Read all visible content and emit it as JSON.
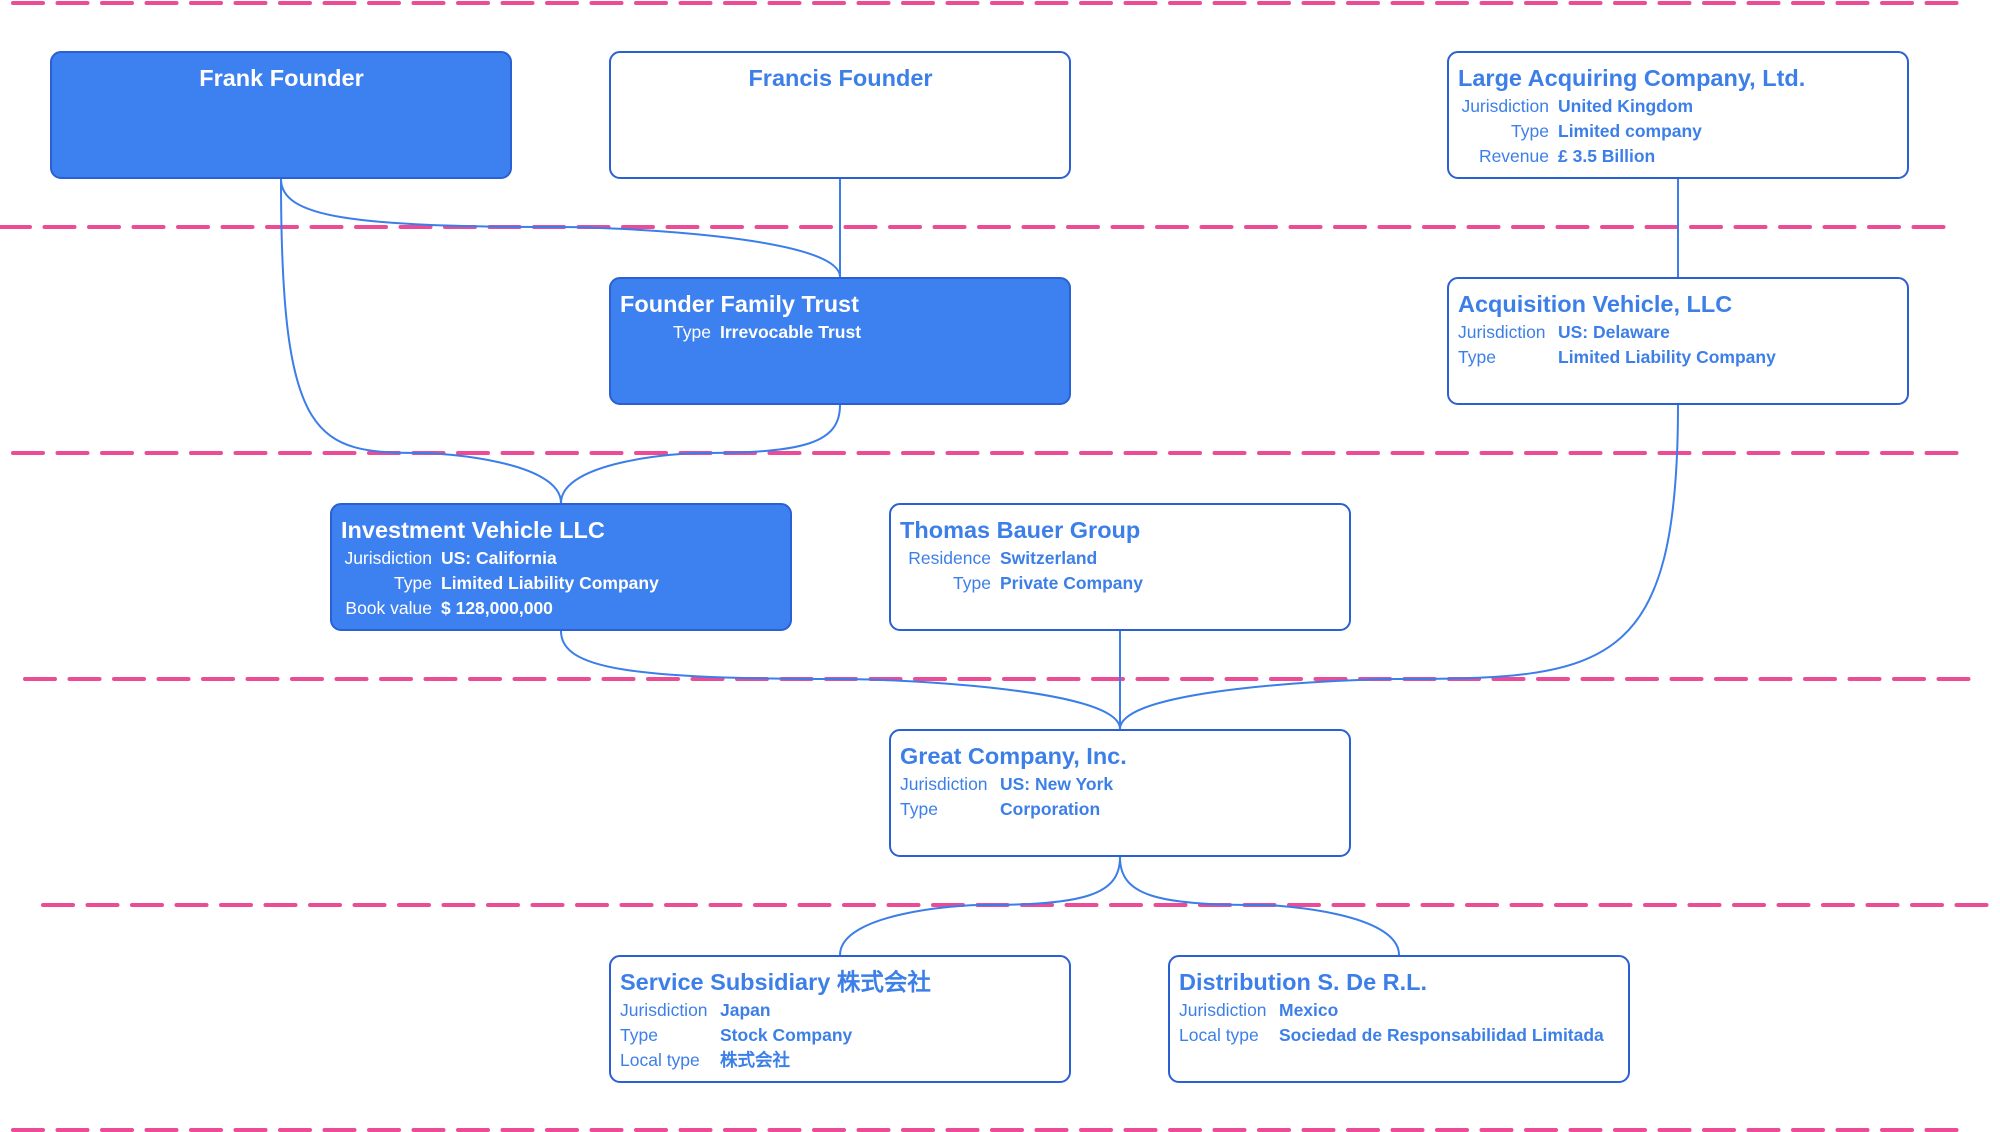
{
  "diagram": {
    "type": "ownership-structure-chart",
    "colors": {
      "filled_node": "#3d80ef",
      "node_border": "#2b5fd4",
      "node_text": "#3d7fe8",
      "edge": "#3b7eea",
      "lane_divider": "#ec4c96"
    },
    "nodes": [
      {
        "id": "frank",
        "title": "Frank Founder",
        "filled": true,
        "rows": []
      },
      {
        "id": "francis",
        "title": "Francis Founder",
        "filled": false,
        "rows": []
      },
      {
        "id": "large_acquiring",
        "title": "Large Acquiring Company, Ltd.",
        "filled": false,
        "rows": [
          {
            "label": "Jurisdiction",
            "value": "United Kingdom"
          },
          {
            "label": "Type",
            "value": "Limited company"
          },
          {
            "label": "Revenue",
            "value": "£ 3.5 Billion"
          }
        ]
      },
      {
        "id": "trust",
        "title": "Founder Family Trust",
        "filled": true,
        "rows": [
          {
            "label": "Type",
            "value": "Irrevocable Trust"
          }
        ]
      },
      {
        "id": "acquisition",
        "title": "Acquisition Vehicle, LLC",
        "filled": false,
        "rows": [
          {
            "label": "Jurisdiction",
            "value": "US: Delaware"
          },
          {
            "label": "Type",
            "value": "Limited Liability Company"
          }
        ]
      },
      {
        "id": "investment",
        "title": "Investment Vehicle LLC",
        "filled": true,
        "rows": [
          {
            "label": "Jurisdiction",
            "value": "US: California"
          },
          {
            "label": "Type",
            "value": "Limited Liability Company"
          },
          {
            "label": "Book value",
            "value": "$ 128,000,000"
          }
        ]
      },
      {
        "id": "thomas",
        "title": "Thomas Bauer Group",
        "filled": false,
        "rows": [
          {
            "label": "Residence",
            "value": "Switzerland"
          },
          {
            "label": "Type",
            "value": "Private Company"
          }
        ]
      },
      {
        "id": "great",
        "title": "Great Company, Inc.",
        "filled": false,
        "rows": [
          {
            "label": "Jurisdiction",
            "value": "US: New York"
          },
          {
            "label": "Type",
            "value": "Corporation"
          }
        ]
      },
      {
        "id": "service",
        "title": "Service Subsidiary 株式会社",
        "filled": false,
        "rows": [
          {
            "label": "Jurisdiction",
            "value": "Japan"
          },
          {
            "label": "Type",
            "value": "Stock Company"
          },
          {
            "label": "Local type",
            "value": "株式会社"
          }
        ]
      },
      {
        "id": "distribution",
        "title": "Distribution S. De R.L.",
        "filled": false,
        "rows": [
          {
            "label": "Jurisdiction",
            "value": "Mexico"
          },
          {
            "label": "Local type",
            "value": "Sociedad de Responsabilidad Limitada"
          }
        ]
      }
    ],
    "edges": [
      {
        "from": "frank",
        "to": "trust"
      },
      {
        "from": "francis",
        "to": "trust"
      },
      {
        "from": "large_acquiring",
        "to": "acquisition"
      },
      {
        "from": "frank",
        "to": "investment"
      },
      {
        "from": "trust",
        "to": "investment"
      },
      {
        "from": "investment",
        "to": "great"
      },
      {
        "from": "thomas",
        "to": "great"
      },
      {
        "from": "acquisition",
        "to": "great"
      },
      {
        "from": "great",
        "to": "service"
      },
      {
        "from": "great",
        "to": "distribution"
      }
    ]
  }
}
